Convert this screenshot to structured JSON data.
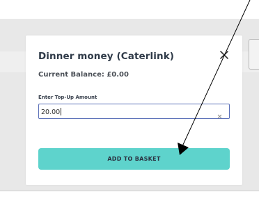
{
  "modal": {
    "title": "Dinner money (Caterlink)",
    "balance": "Current Balance: £0.00",
    "amount_label": "Enter Top-Up Amount",
    "amount_value": "20.00",
    "add_button_label": "ADD TO BASKET"
  },
  "colors": {
    "accent": "#5ed3cc",
    "field_border": "#5a6fb8",
    "title_text": "#2f3a48"
  },
  "icons": {
    "close": "close-icon",
    "clear": "clear-input-icon",
    "annotation": "arrow-pointer"
  }
}
